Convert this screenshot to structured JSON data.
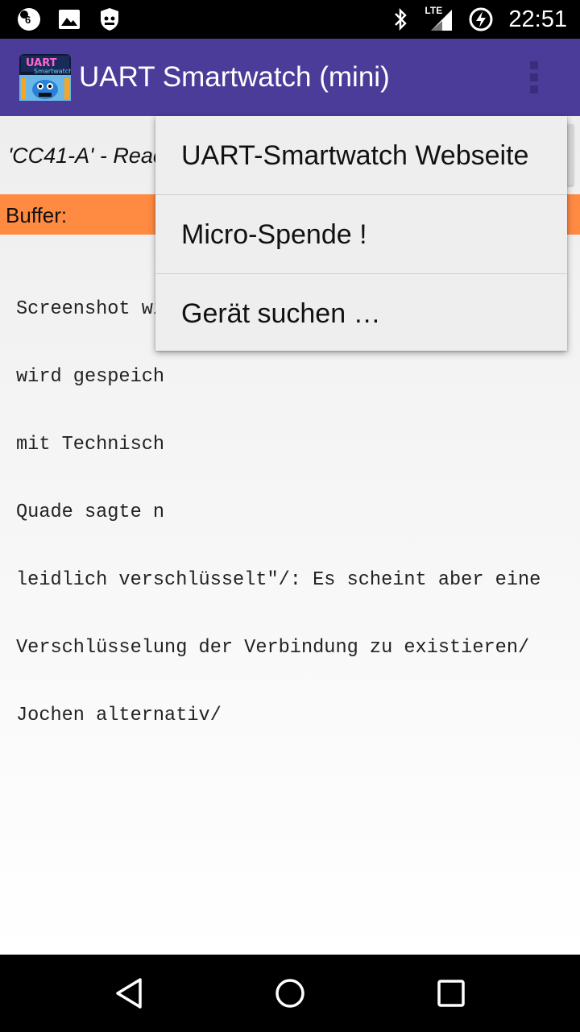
{
  "status_bar": {
    "time": "22:51",
    "notification_badge": "6",
    "network_type": "LTE",
    "left_icons": [
      "notification-count-icon",
      "image-icon",
      "android-robot-icon"
    ],
    "right_icons": [
      "bluetooth-icon",
      "lte-signal-icon",
      "battery-charging-icon"
    ]
  },
  "app_bar": {
    "title": "UART Smartwatch (mini)",
    "logo_text_top": "UART",
    "logo_text_bottom": "Smartwatch",
    "overflow_icon": "more-vert-icon"
  },
  "device_row": {
    "label": "'CC41-A' - Reac"
  },
  "buffer": {
    "label": "Buffer:"
  },
  "log_lines": [
    "Screenshot wi",
    "wird gespeich",
    "mit Technisch",
    "Quade sagte n",
    "leidlich verschlüsselt\"/: Es scheint aber eine",
    "Verschlüsselung der Verbindung zu existieren/",
    "Jochen alternativ/"
  ],
  "menu": {
    "items": [
      {
        "label": "UART-Smartwatch Webseite"
      },
      {
        "label": "Micro-Spende !"
      },
      {
        "label": "Gerät suchen …"
      }
    ]
  },
  "nav_bar": {
    "icons": [
      "back-icon",
      "home-icon",
      "recents-icon"
    ]
  },
  "colors": {
    "app_bar": "#4b3c9a",
    "buffer_bar": "#ff8a42",
    "menu_bg": "#eeeeee"
  }
}
